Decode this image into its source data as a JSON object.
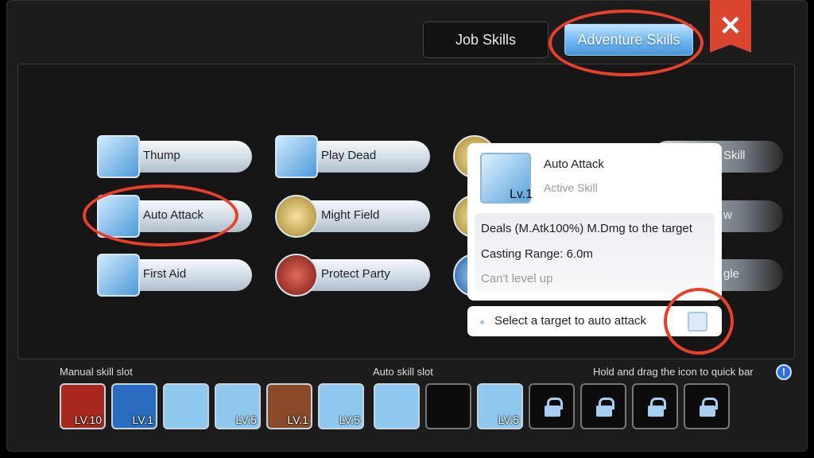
{
  "tabs": [
    {
      "label": "Job Skills",
      "active": false
    },
    {
      "label": "Adventure Skills",
      "active": true
    }
  ],
  "close_icon": "close-x-icon",
  "skills": [
    {
      "label": "Thump",
      "icon": "fist-icon"
    },
    {
      "label": "Play Dead",
      "icon": "lying-figure-icon"
    },
    {
      "label": "Auto Attack",
      "icon": "sword-burst-icon"
    },
    {
      "label": "Might Field",
      "icon": "fist-glow-icon"
    },
    {
      "label": "First Aid",
      "icon": "cross-icon"
    },
    {
      "label": "Protect Party",
      "icon": "shield-figure-icon"
    },
    {
      "label": "Skill",
      "icon": "skill-icon"
    },
    {
      "label": "w",
      "icon": "skill-icon"
    },
    {
      "label": "gle",
      "icon": "skill-icon"
    }
  ],
  "popup": {
    "title": "Auto Attack",
    "type": "Active Skill",
    "level": "Lv.1",
    "description": "Deals (M.Atk100%) M.Dmg to the target",
    "range": "Casting Range: 6.0m",
    "status": "Can't level up",
    "auto_target_label": "Select a target to auto attack",
    "auto_target_checked": false
  },
  "bottom": {
    "manual_label": "Manual skill slot",
    "auto_label": "Auto skill slot",
    "hint": "Hold and drag the icon to quick bar",
    "info_icon": "!",
    "manual_slots": [
      {
        "level": "LV.10",
        "color": "#a8281f"
      },
      {
        "level": "LV.1",
        "color": "#2a6cc0"
      },
      {
        "level": "",
        "color": "#8ec8ef"
      },
      {
        "level": "LV.5",
        "color": "#8ec8ef"
      },
      {
        "level": "LV.1",
        "color": "#8a4a2a"
      },
      {
        "level": "LV.5",
        "color": "#8ec8ef"
      }
    ],
    "auto_slots": [
      {
        "level": "",
        "color": "#8ec8ef",
        "locked": false
      },
      {
        "level": "",
        "color": "#0c0c0c",
        "locked": false
      },
      {
        "level": "LV.5",
        "color": "#8ec8ef",
        "locked": false
      },
      {
        "level": "",
        "color": "#0c0c0c",
        "locked": true
      },
      {
        "level": "",
        "color": "#0c0c0c",
        "locked": true
      },
      {
        "level": "",
        "color": "#0c0c0c",
        "locked": true
      },
      {
        "level": "",
        "color": "#0c0c0c",
        "locked": true
      }
    ]
  },
  "colors": {
    "accent": "#6fb6f2",
    "annotation": "#e8402a",
    "close": "#d9452e"
  }
}
